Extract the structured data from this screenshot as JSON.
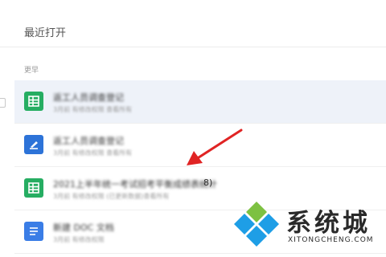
{
  "header": {
    "title": "最近打开"
  },
  "section": {
    "label": "更早"
  },
  "files": [
    {
      "icon": "spreadsheet-icon",
      "title": "返工人员调查登记",
      "meta": "3月前  有修改权限  查看所有",
      "selected": true
    },
    {
      "icon": "document-icon",
      "title": "返工人员调查登记",
      "meta": "3月前  有修改权限  查看所有",
      "selected": false
    },
    {
      "icon": "spreadsheet-icon",
      "title": "2021上半年统一考试招考平衡成绩表统计",
      "title_suffix": "8)",
      "meta": "3月前  有修改权限  (已更新数据)查看所有",
      "selected": false
    },
    {
      "icon": "note-icon",
      "title": "新建 DOC 文档",
      "meta": "3月前  有修改权限",
      "selected": false
    }
  ],
  "watermark": {
    "text": "系统城",
    "sub": "XITONGCHENG.COM"
  },
  "colors": {
    "sheet_green": "#26ad62",
    "doc_blue": "#2d73d8",
    "selected_row_bg": "#eef2f9",
    "arrow_red": "#e02424",
    "logo_green": "#7dc142",
    "logo_blue": "#1e9ee6"
  }
}
